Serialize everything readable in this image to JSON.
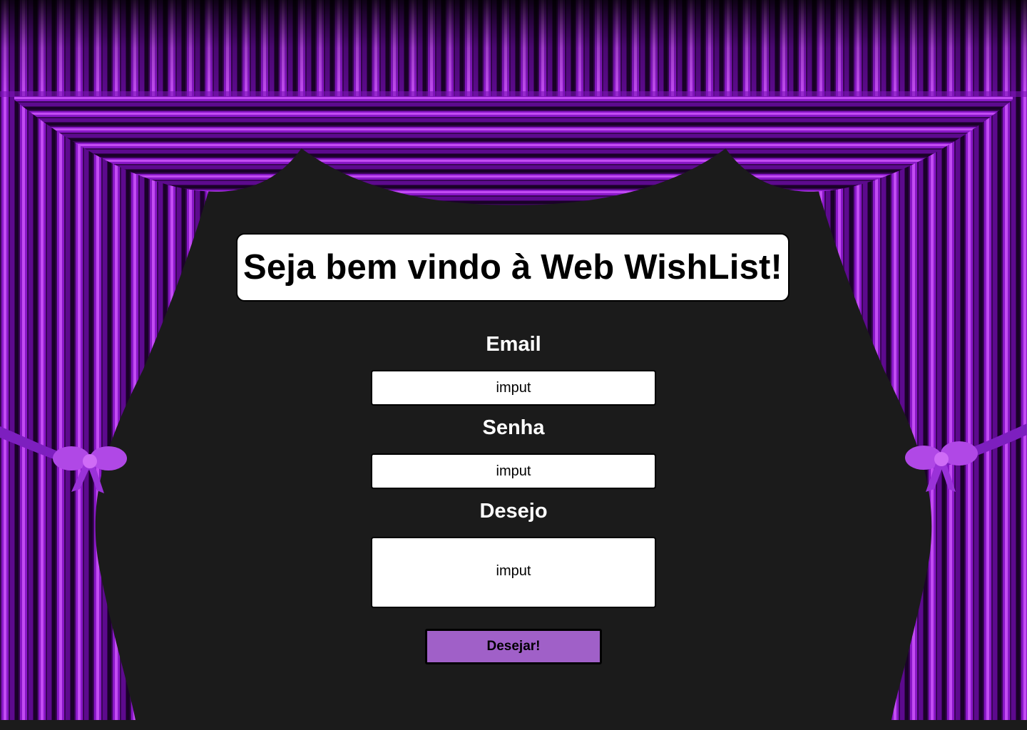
{
  "page": {
    "title": "Seja bem vindo à Web WishList!",
    "background_color": "#1b1b1b",
    "curtain_color": "#9b1fd6"
  },
  "form": {
    "email": {
      "label": "Email",
      "placeholder": "imput"
    },
    "password": {
      "label": "Senha",
      "placeholder": "imput"
    },
    "wish": {
      "label": "Desejo",
      "placeholder": "imput"
    },
    "submit_label": "Desejar!",
    "submit_color": "#a060c8"
  }
}
